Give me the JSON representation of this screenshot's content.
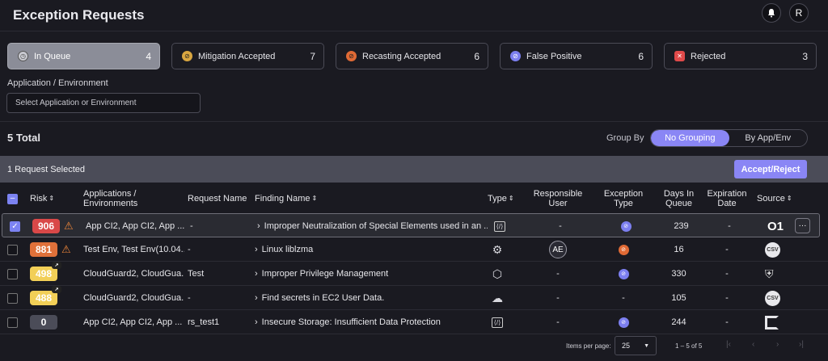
{
  "header": {
    "title": "Exception Requests",
    "avatar_initial": "R"
  },
  "status_cards": [
    {
      "label": "In Queue",
      "count": "4",
      "icon": "clock-icon",
      "color": "#b6b8c1"
    },
    {
      "label": "Mitigation Accepted",
      "count": "7",
      "icon": "mitigation-icon",
      "color": "#d9a640"
    },
    {
      "label": "Recasting Accepted",
      "count": "6",
      "icon": "recast-icon",
      "color": "#e06a35"
    },
    {
      "label": "False Positive",
      "count": "6",
      "icon": "false-positive-icon",
      "color": "#7c7ff0"
    },
    {
      "label": "Rejected",
      "count": "3",
      "icon": "reject-icon",
      "color": "#e04a4a"
    }
  ],
  "filter": {
    "label": "Application / Environment",
    "placeholder": "Select Application or Environment"
  },
  "total": "5  Total",
  "group_by": {
    "label": "Group By",
    "options": [
      "No Grouping",
      "By App/Env"
    ],
    "selected": "No Grouping"
  },
  "selection": {
    "text": "1 Request Selected",
    "action": "Accept/Reject"
  },
  "columns": {
    "risk": "Risk",
    "apps": "Applications / Environments",
    "request": "Request Name",
    "finding": "Finding Name",
    "type": "Type",
    "user": "Responsible User",
    "exception": "Exception Type",
    "days": "Days In Queue",
    "expiration": "Expiration Date",
    "source": "Source"
  },
  "rows": [
    {
      "risk": "906",
      "risk_color": "#d94848",
      "warn": true,
      "apps": "App CI2, App CI2, App ...",
      "request": "-",
      "finding": "Improper Neutralization of Special Elements used in an ...",
      "type_icon": "code-icon",
      "user": "-",
      "exception_color": "#7c7ff0",
      "days": "239",
      "expiration": "-",
      "source": "source-o1-logo",
      "source_text": "O1",
      "selected": true
    },
    {
      "risk": "881",
      "risk_color": "#e0713a",
      "warn": true,
      "apps": "Test Env, Test Env(10.04...",
      "request": "-",
      "finding": "Linux liblzma",
      "type_icon": "gear-icon",
      "user": "AE",
      "exception_color": "#e06a35",
      "days": "16",
      "expiration": "-",
      "source": "csv-icon",
      "source_text": "CSV",
      "selected": false
    },
    {
      "risk": "498",
      "risk_color": "#f2cf57",
      "warn": false,
      "apps": "CloudGuard2, CloudGua...",
      "request": "Test",
      "finding": "Improper Privilege Management",
      "type_icon": "package-icon",
      "user": "-",
      "exception_color": "#7c7ff0",
      "days": "330",
      "expiration": "-",
      "source": "cloudguard-icon",
      "source_text": "",
      "selected": false
    },
    {
      "risk": "488",
      "risk_color": "#f2cf57",
      "warn": false,
      "apps": "CloudGuard2, CloudGua...",
      "request": "-",
      "finding": "Find secrets in EC2 User Data.",
      "type_icon": "cloud-icon",
      "user": "-",
      "exception_color": "",
      "days": "105",
      "expiration": "-",
      "source": "csv-icon",
      "source_text": "CSV",
      "selected": false
    },
    {
      "risk": "0",
      "risk_color": "#4b4c58",
      "warn": false,
      "apps": "App CI2, App CI2, App ...",
      "request": "rs_test1",
      "finding": "Insecure Storage: Insufficient Data Protection",
      "type_icon": "code-icon",
      "user": "-",
      "exception_color": "#7c7ff0",
      "days": "244",
      "expiration": "-",
      "source": "bracket-logo",
      "source_text": "",
      "selected": false
    }
  ],
  "pagination": {
    "items_per_page_label": "Items per page:",
    "items_per_page": "25",
    "range": "1 – 5 of 5"
  }
}
